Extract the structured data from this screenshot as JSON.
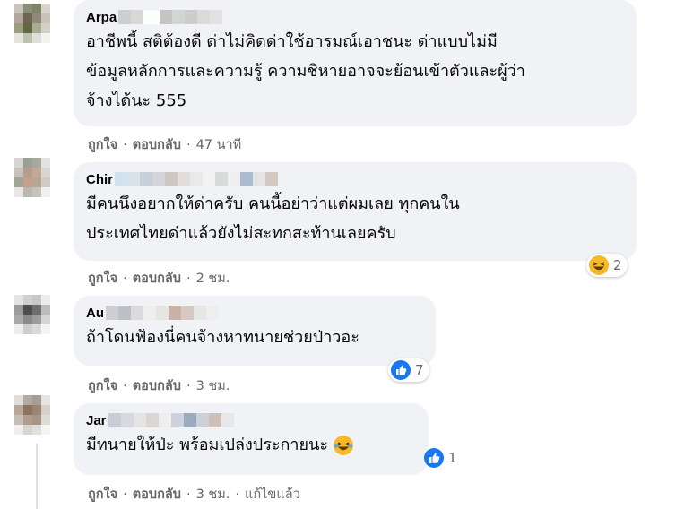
{
  "comments": [
    {
      "author": "Arpa",
      "text": "อาชีพนี้ สติต้องดี ด่าไม่คิดด่าใช้อารมณ์เอาชนะ ด่าแบบไม่มี\nข้อมูลหลักการและความรู้ ความชิหายอาจจะย้อนเข้าตัวและผู้ว่า\nจ้างได้นะ 555",
      "like": "ถูกใจ",
      "reply": "ตอบกลับ",
      "time": "47 นาที"
    },
    {
      "author": "Chir",
      "text": "มีคนนึงอยากให้ด่าครับ คนนี้อย่าว่าแต่ผมเลย ทุกคนใน\nประเทศไทยด่าแล้วยังไม่สะทกสะท้านเลยครับ",
      "like": "ถูกใจ",
      "reply": "ตอบกลับ",
      "time": "2 ชม.",
      "reaction": {
        "icon": "haha-emoji-icon",
        "count": "2"
      }
    },
    {
      "author": "Au",
      "text": "ถ้าโดนฟ้องนี่คนจ้างหาทนายช่วยป่าวอะ",
      "like": "ถูกใจ",
      "reply": "ตอบกลับ",
      "time": "3 ชม.",
      "reaction": {
        "icon": "like-thumb-icon",
        "count": "7"
      }
    },
    {
      "author": "Jar",
      "text": "มีทนายให้ป่ะ พร้อมเปล่งประกายนะ",
      "like": "ถูกใจ",
      "reply": "ตอบกลับ",
      "time": "3 ชม.",
      "edited": "แก้ไขแล้ว",
      "reaction": {
        "icon": "like-thumb-icon",
        "count": "1"
      }
    }
  ],
  "colors": {
    "bubble": "#f0f2f5",
    "meta": "#65676b",
    "like_blue": "#1877f2",
    "haha_yellow": "#f7b928"
  }
}
